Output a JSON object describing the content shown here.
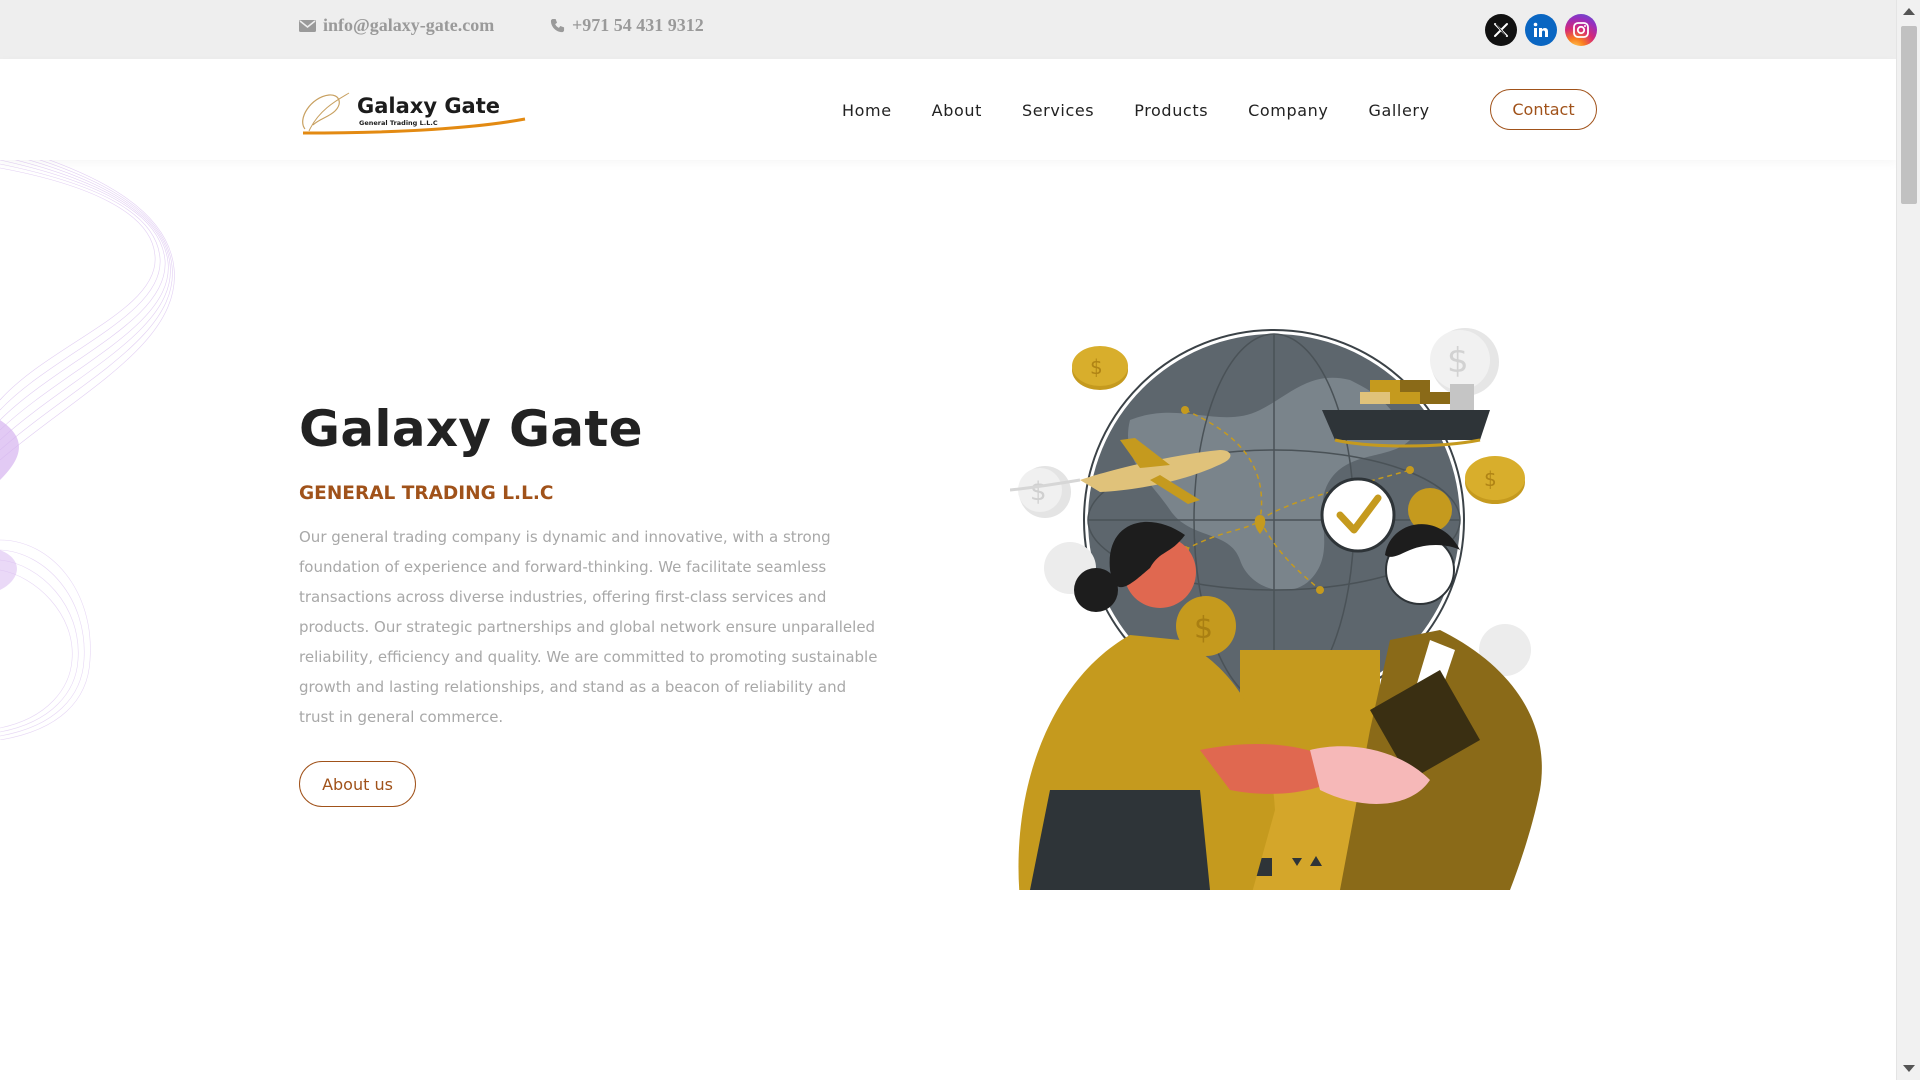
{
  "topbar": {
    "email": "info@galaxy-gate.com",
    "phone": "+971 54 431 9312",
    "email_icon": "envelope-icon",
    "phone_icon": "phone-icon",
    "social": [
      "x-twitter-icon",
      "linkedin-icon",
      "instagram-icon"
    ]
  },
  "brand": {
    "name": "Galaxy Gate",
    "tagline": "General Trading L.L.C"
  },
  "nav": {
    "items": [
      "Home",
      "About",
      "Services",
      "Products",
      "Company",
      "Gallery"
    ],
    "contact_label": "Contact"
  },
  "hero": {
    "title": "Galaxy Gate",
    "subtitle": "GENERAL TRADING L.L.C",
    "description": "Our general trading company is dynamic and innovative, with a strong foundation of experience and forward-thinking. We facilitate seamless transactions across diverse industries, offering first-class services and products. Our strategic partnerships and global network ensure unparalleled reliability, efficiency and quality. We are committed to promoting sustainable growth and lasting relationships, and stand as a beacon of reliability and trust in general commerce.",
    "button_label": "About us"
  },
  "colors": {
    "accent": "#a0521a",
    "gold": "#c59a1e",
    "topbar_bg": "#eeeeee"
  }
}
